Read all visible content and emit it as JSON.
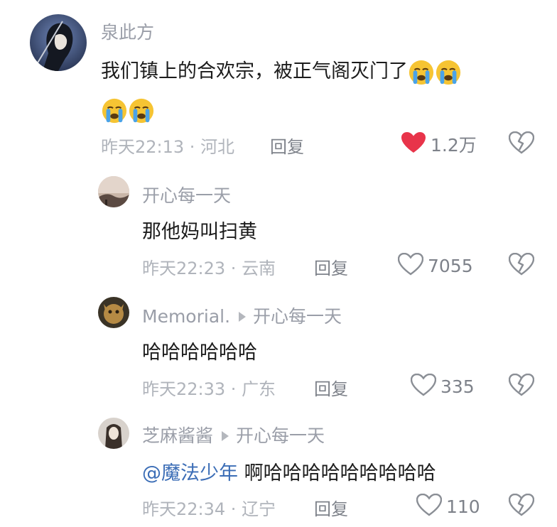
{
  "top_comment": {
    "username": "泉此方",
    "text": "我们镇上的合欢宗，被正气阁灭门了",
    "emojis": [
      "crying-face",
      "crying-face",
      "crying-face",
      "crying-face"
    ],
    "time": "昨天22:13",
    "location": "河北",
    "reply_label": "回复",
    "likes": "1.2万",
    "liked": true,
    "like_color": "#e8344a"
  },
  "replies": [
    {
      "username": "开心每一天",
      "text": "那他妈叫扫黄",
      "time": "昨天22:23",
      "location": "云南",
      "reply_label": "回复",
      "likes": "7055"
    },
    {
      "username": "Memorial.",
      "reply_to": "开心每一天",
      "text": "哈哈哈哈哈哈",
      "time": "昨天22:33",
      "location": "广东",
      "reply_label": "回复",
      "likes": "335"
    },
    {
      "username": "芝麻酱酱",
      "reply_to": "开心每一天",
      "mention": "@魔法少年",
      "text": "啊哈哈哈哈哈哈哈哈哈",
      "time": "昨天22:34",
      "location": "辽宁",
      "reply_label": "回复",
      "likes": "110"
    }
  ],
  "separator": " · ",
  "colors": {
    "mention": "#3b6db6",
    "heart_outline": "#8a8e95",
    "emoji_face": "#f6c433",
    "tear": "#4aa3e8"
  }
}
